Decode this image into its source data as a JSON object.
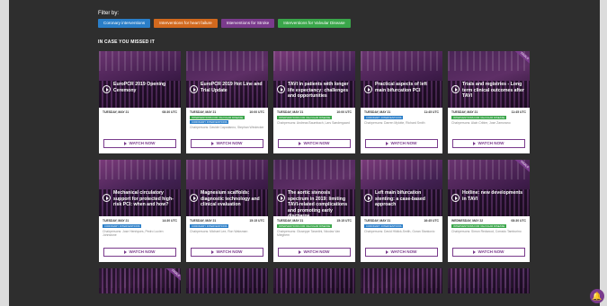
{
  "filter_label": "Filter by:",
  "filters": [
    {
      "label": "Coronary interventions",
      "color": "#2a7ec8"
    },
    {
      "label": "Interventions for heart failure",
      "color": "#d2691e"
    },
    {
      "label": "Interventions for Stroke",
      "color": "#7a3b8c"
    },
    {
      "label": "Interventions for Valvular Disease",
      "color": "#3aa64a"
    }
  ],
  "section_title": "IN CASE YOU MISSED IT",
  "watch_label": "WATCH NOW",
  "cards": [
    {
      "title": "EuroPCR 2019 Opening Ceremony",
      "date": "TUESDAY, MAY 21",
      "time": "08:30 UTC",
      "tags": [],
      "chair": "",
      "ribbon": "",
      "variant": "v1"
    },
    {
      "title": "EuroPCR 2019 Hot Line and Trial Update",
      "date": "TUESDAY, MAY 21",
      "time": "10:00 UTC",
      "tags": [
        {
          "label": "INTERVENTIONS FOR VALVULAR DISEASE",
          "color": "green"
        },
        {
          "label": "CORONARY INTERVENTIONS",
          "color": "blue"
        }
      ],
      "chair": "Chairpersons: Davide Capodanno, Stephan Windecker",
      "ribbon": "",
      "variant": "v2"
    },
    {
      "title": "TAVI in patients with longer life expectancy: challenges and opportunities",
      "date": "TUESDAY, MAY 21",
      "time": "10:00 UTC",
      "tags": [
        {
          "label": "INTERVENTIONS FOR VALVULAR DISEASE",
          "color": "green"
        }
      ],
      "chair": "Chairpersons: Andreas Baumbach, Lars Søndergaard",
      "ribbon": "",
      "variant": "v3"
    },
    {
      "title": "Practical aspects of left main bifurcation PCI",
      "date": "TUESDAY, MAY 21",
      "time": "11:45 UTC",
      "tags": [
        {
          "label": "CORONARY INTERVENTIONS",
          "color": "blue"
        }
      ],
      "chair": "Chairpersons: Darren Mylotte, Richard Smith",
      "ribbon": "",
      "variant": "v1"
    },
    {
      "title": "Trials and registries - Long term clinical outcomes after TAVI",
      "date": "TUESDAY, MAY 21",
      "time": "11:45 UTC",
      "tags": [
        {
          "label": "INTERVENTIONS FOR VALVULAR DISEASE",
          "color": "green"
        }
      ],
      "chair": "Chairpersons: Alain Cribier, Jose Zamorano",
      "ribbon": "TRIALS",
      "variant": "v2"
    },
    {
      "title": "Mechanical circulatory support for protected high-risk PCI: when and how?",
      "date": "TUESDAY, MAY 21",
      "time": "14:30 UTC",
      "tags": [
        {
          "label": "CORONARY INTERVENTIONS",
          "color": "blue"
        }
      ],
      "chair": "Chairpersons: Jose Henriques, Pedro Lucien Johnstone",
      "ribbon": "",
      "variant": "v3"
    },
    {
      "title": "Magnesium scaffolds: diagnostic technology and clinical evaluation",
      "date": "TUESDAY, MAY 21",
      "time": "15:15 UTC",
      "tags": [
        {
          "label": "CORONARY INTERVENTIONS",
          "color": "blue"
        }
      ],
      "chair": "Chairpersons: Michael Lee, Ron Waksman",
      "ribbon": "",
      "variant": "v1"
    },
    {
      "title": "The aortic stenosis spectrum in 2019: limiting TAVI-related complications and promoting early discharge",
      "date": "TUESDAY, MAY 21",
      "time": "15:15 UTC",
      "tags": [
        {
          "label": "INTERVENTIONS FOR VALVULAR DISEASE",
          "color": "green"
        }
      ],
      "chair": "Chairpersons: Giuseppe Tarantini, Nicolas Van Mieghem",
      "ribbon": "",
      "variant": "v2"
    },
    {
      "title": "Left main bifurcation stenting: a case-based approach",
      "date": "TUESDAY, MAY 21",
      "time": "16:45 UTC",
      "tags": [
        {
          "label": "CORONARY INTERVENTIONS",
          "color": "blue"
        }
      ],
      "chair": "Chairpersons: David Hildick-Smith, Goran Stankovic",
      "ribbon": "",
      "variant": "v3"
    },
    {
      "title": "Hotline: new developments in TAVI",
      "date": "WEDNESDAY, MAY 22",
      "time": "08:30 UTC",
      "tags": [
        {
          "label": "INTERVENTIONS FOR VALVULAR DISEASE",
          "color": "green"
        }
      ],
      "chair": "Chairpersons: Simon Redwood, Corrado Tamburino",
      "ribbon": "TRIALS",
      "variant": "v1"
    }
  ],
  "partial_cards": [
    {
      "ribbon": "TRIALS",
      "variant": "v2"
    },
    {
      "ribbon": "",
      "variant": "v3"
    },
    {
      "ribbon": "",
      "variant": "v1"
    },
    {
      "ribbon": "",
      "variant": "v2"
    },
    {
      "ribbon": "",
      "variant": "v3"
    }
  ],
  "icons": {
    "play": "play-icon",
    "bell": "bell-icon"
  }
}
